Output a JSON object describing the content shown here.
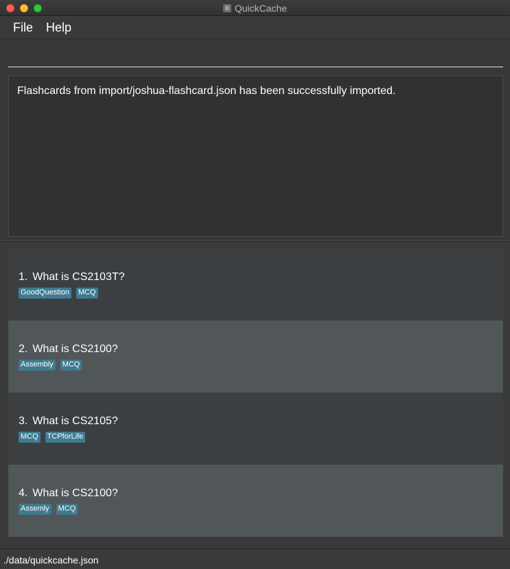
{
  "window": {
    "title": "QuickCache"
  },
  "menu": {
    "file_label": "File",
    "help_label": "Help"
  },
  "command": {
    "value": ""
  },
  "result": {
    "message": "Flashcards from import/joshua-flashcard.json has been successfully imported."
  },
  "flashcards": [
    {
      "index": "1.",
      "question": "What is CS2103T?",
      "tags": [
        "GoodQuestion",
        "MCQ"
      ]
    },
    {
      "index": "2.",
      "question": "What is CS2100?",
      "tags": [
        "Assembly",
        "MCQ"
      ]
    },
    {
      "index": "3.",
      "question": "What is CS2105?",
      "tags": [
        "MCQ",
        "TCPforLife"
      ]
    },
    {
      "index": "4.",
      "question": "What is CS2100?",
      "tags": [
        "Assemly",
        "MCQ"
      ]
    }
  ],
  "status": {
    "file_path": "./data/quickcache.json"
  },
  "colors": {
    "tag": "#3e7b91",
    "card_odd": "#3c3f41",
    "card_even": "#515658"
  }
}
